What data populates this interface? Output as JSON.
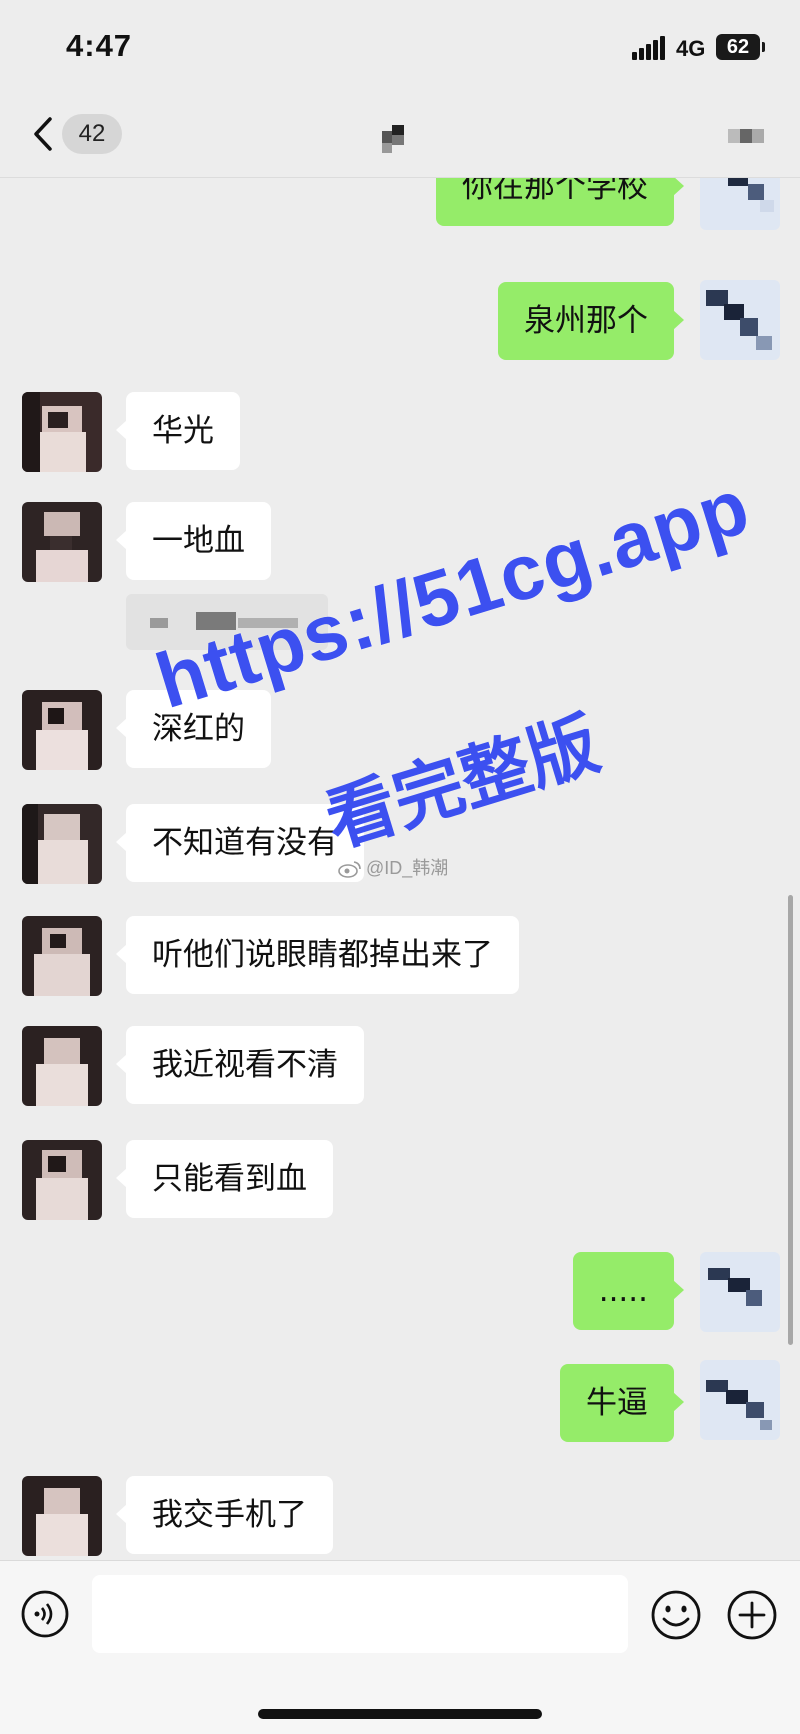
{
  "status_bar": {
    "time": "4:47",
    "network": "4G",
    "battery": "62"
  },
  "nav": {
    "unread_count": "42"
  },
  "messages": [
    {
      "side": "out",
      "text": "你在那个学校"
    },
    {
      "side": "out",
      "text": "泉州那个"
    },
    {
      "side": "in",
      "text": "华光"
    },
    {
      "side": "in",
      "text": "一地血"
    },
    {
      "side": "in",
      "text": "深红的"
    },
    {
      "side": "in",
      "text": "不知道有没有"
    },
    {
      "side": "in",
      "text": "听他们说眼睛都掉出来了"
    },
    {
      "side": "in",
      "text": "我近视看不清"
    },
    {
      "side": "in",
      "text": "只能看到血"
    },
    {
      "side": "out",
      "text": "....."
    },
    {
      "side": "out",
      "text": "牛逼"
    },
    {
      "side": "in",
      "text": "我交手机了"
    }
  ],
  "watermark": {
    "url": "https://51cg.app",
    "subtitle": "看完整版",
    "weibo": "@ID_韩潮"
  },
  "colors": {
    "sent_bubble": "#95ec69",
    "received_bubble": "#ffffff",
    "background": "#ededed",
    "watermark": "#3c50f0"
  },
  "icons": [
    "chevron-left-icon",
    "more-icon",
    "voice-icon",
    "emoji-icon",
    "plus-icon",
    "weibo-icon"
  ]
}
